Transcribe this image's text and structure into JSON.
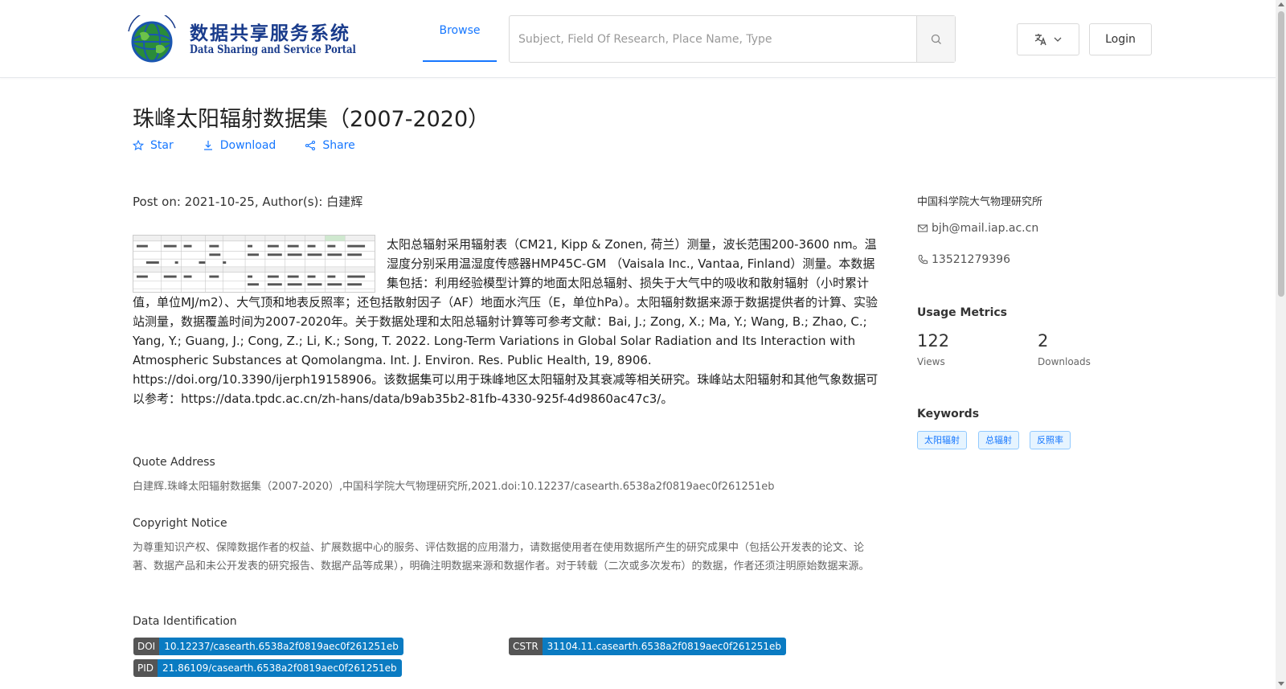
{
  "header": {
    "logo_cn": "数据共享服务系统",
    "logo_en": "Data Sharing and Service Portal",
    "browse_label": "Browse",
    "search_placeholder": "Subject, Field Of Research, Place Name, Type",
    "login_label": "Login"
  },
  "dataset": {
    "title": "珠峰太阳辐射数据集（2007-2020）",
    "actions": {
      "star": "Star",
      "download": "Download",
      "share": "Share"
    },
    "post_on_prefix": "Post on: 2021-10-25, Author(s): ",
    "author": "白建辉",
    "description": "太阳总辐射采用辐射表（CM21, Kipp & Zonen, 荷兰）测量，波长范围200-3600 nm。温湿度分别采用温湿度传感器HMP45C-GM （Vaisala Inc., Vantaa, Finland）测量。本数据集包括：利用经验模型计算的地面太阳总辐射、损失于大气中的吸收和散射辐射（小时累计值，单位MJ/m2）、大气顶和地表反照率；还包括散射因子（AF）地面水汽压（E，单位hPa）。太阳辐射数据来源于数据提供者的计算、实验站测量，数据覆盖时间为2007-2020年。关于数据处理和太阳总辐射计算等可参考文献：Bai, J.; Zong, X.; Ma, Y.; Wang, B.; Zhao, C.; Yang, Y.; Guang, J.; Cong, Z.; Li, K.; Song, T. 2022. Long-Term Variations in Global Solar Radiation and Its Interaction with Atmospheric Substances at Qomolangma. Int. J. Environ. Res. Public Health, 19, 8906. https://doi.org/10.3390/ijerph19158906。该数据集可以用于珠峰地区太阳辐射及其衰减等相关研究。珠峰站太阳辐射和其他气象数据可以参考：https://data.tpdc.ac.cn/zh-hans/data/b9ab35b2-81fb-4330-925f-4d9860ac47c3/。",
    "quote_title": "Quote Address",
    "quote_text": "白建辉.珠峰太阳辐射数据集（2007-2020）,中国科学院大气物理研究所,2021.doi:10.12237/casearth.6538a2f0819aec0f261251eb",
    "copyright_title": "Copyright Notice",
    "copyright_text": "为尊重知识产权、保障数据作者的权益、扩展数据中心的服务、评估数据的应用潜力，请数据使用者在使用数据所产生的研究成果中（包括公开发表的论文、论著、数据产品和未公开发表的研究报告、数据产品等成果），明确注明数据来源和数据作者。对于转载（二次或多次发布）的数据，作者还须注明原始数据来源。",
    "identification_title": "Data Identification",
    "ids": {
      "doi_key": "DOI",
      "doi_val": "10.12237/casearth.6538a2f0819aec0f261251eb",
      "cstr_key": "CSTR",
      "cstr_val": "31104.11.casearth.6538a2f0819aec0f261251eb",
      "pid_key": "PID",
      "pid_val": "21.86109/casearth.6538a2f0819aec0f261251eb"
    }
  },
  "sidebar": {
    "org": "中国科学院大气物理研究所",
    "email": "bjh@mail.iap.ac.cn",
    "phone": "13521279396",
    "usage_title": "Usage Metrics",
    "views_count": "122",
    "views_label": "Views",
    "downloads_count": "2",
    "downloads_label": "Downloads",
    "keywords_title": "Keywords",
    "keywords": [
      "太阳辐射",
      "总辐射",
      "反照率"
    ]
  },
  "colors": {
    "accent": "#1677ff",
    "badge_value": "#0a7bc2",
    "badge_key": "#555555"
  }
}
